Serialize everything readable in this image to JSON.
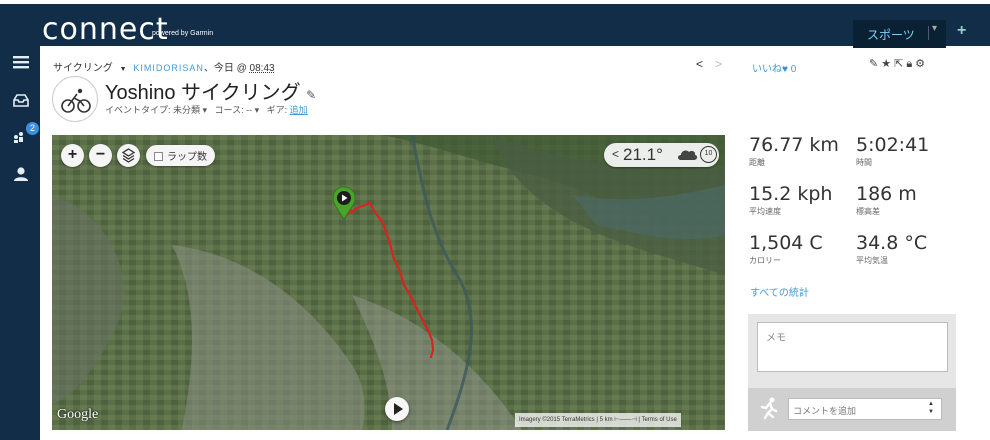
{
  "app": {
    "logo_text": "connect",
    "logo_sub": "powered by Garmin",
    "sports_button": "スポーツ",
    "plus": "+"
  },
  "sidebar": {
    "badge_count": "2",
    "icons": [
      "menu-icon",
      "inbox-icon",
      "connections-icon",
      "profile-icon"
    ]
  },
  "breadcrumb": {
    "sport": "サイクリング",
    "caret": "▼",
    "user": "KIMIDORISAN",
    "date": "、今日 @ ",
    "time": "08:43"
  },
  "activity": {
    "title": "Yoshino サイクリング",
    "event_type_label": "イベントタイプ: 未分類 ▾",
    "course_label": "コース: -- ▾",
    "gear_label": "ギア: ",
    "gear_link": "追加"
  },
  "map": {
    "lap_label": "ラップ数",
    "temperature": "21.1°",
    "google": "Google",
    "attribution": "Imagery ©2015 TerraMetrics | 5 km ⊢——⊣ | Terms of Use",
    "weather_icon": "cloud-icon",
    "time_badge": "10"
  },
  "social": {
    "like_label": "いいね",
    "like_count": "0"
  },
  "stats": {
    "distance": {
      "value": "76.77 km",
      "label": "距離"
    },
    "time": {
      "value": "5:02:41",
      "label": "時間"
    },
    "avg_speed": {
      "value": "15.2 kph",
      "label": "平均速度"
    },
    "elevation": {
      "value": "186 m",
      "label": "標高差"
    },
    "calories": {
      "value": "1,504 C",
      "label": "カロリー"
    },
    "avg_temp": {
      "value": "34.8 °C",
      "label": "平均気温"
    },
    "all_stats_link": "すべての統計"
  },
  "notes": {
    "memo_placeholder": "メモ",
    "comment_placeholder": "コメントを追加"
  },
  "colors": {
    "nav_bg": "#122d48",
    "accent": "#3f9bd8",
    "route": "#d8231f",
    "start_pin": "#4aa32a"
  }
}
